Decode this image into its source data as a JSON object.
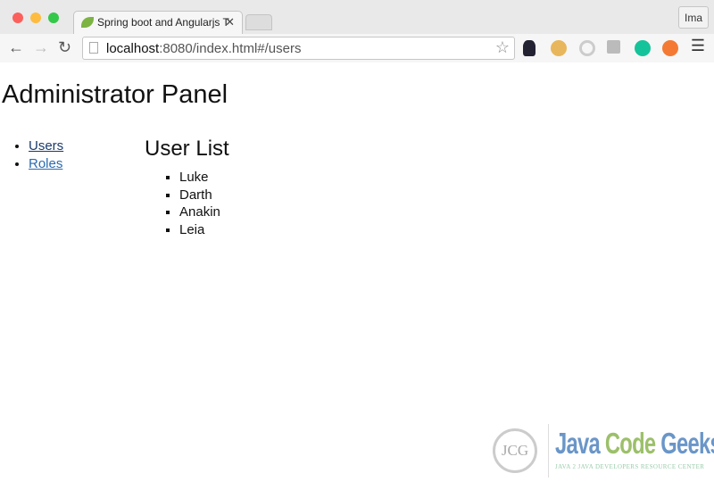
{
  "browser": {
    "tab_title": "Spring boot and Angularjs T",
    "url_host": "localhost",
    "url_path": ":8080/index.html#/users",
    "profile_label": "Ima"
  },
  "page": {
    "title": "Administrator Panel",
    "nav": [
      {
        "label": "Users",
        "active": true
      },
      {
        "label": "Roles",
        "active": false
      }
    ],
    "section_title": "User List",
    "users": [
      "Luke",
      "Darth",
      "Anakin",
      "Leia"
    ]
  },
  "watermark": {
    "brand_java": "Java",
    "brand_code": "Code",
    "brand_geeks": "Geeks",
    "monogram": "JCG",
    "tagline": "Java 2 Java Developers Resource Center"
  },
  "colors": {
    "link": "#2a6ab0",
    "close": "#fc605c",
    "minimize": "#fdbc40",
    "maximize": "#34c84a"
  }
}
